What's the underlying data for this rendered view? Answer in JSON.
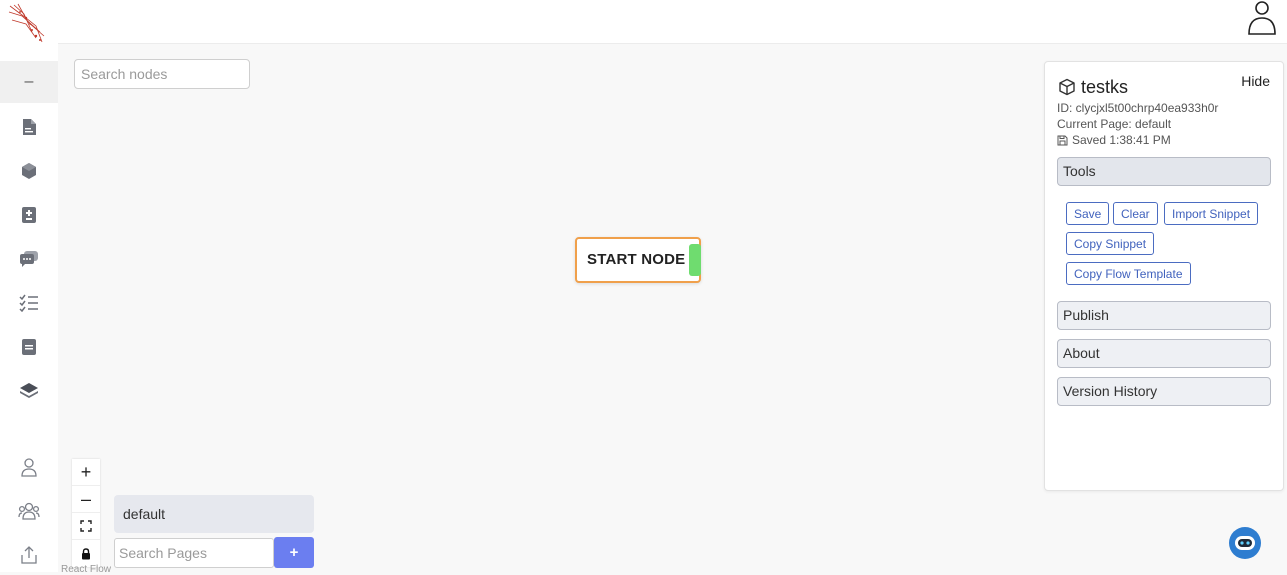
{
  "sidebar": {
    "collapse_label": "–",
    "items": [
      {
        "icon": "document-icon"
      },
      {
        "icon": "cube-icon"
      },
      {
        "icon": "file-plus-minus-icon"
      },
      {
        "icon": "chat-bubble-icon"
      },
      {
        "icon": "checklist-icon"
      },
      {
        "icon": "note-icon"
      },
      {
        "icon": "layers-icon"
      }
    ],
    "bottom_items": [
      {
        "icon": "user-icon"
      },
      {
        "icon": "users-icon"
      },
      {
        "icon": "share-upload-icon"
      }
    ]
  },
  "canvas": {
    "search_nodes_placeholder": "Search nodes",
    "start_node_label": "START NODE",
    "attribution": "React Flow"
  },
  "zoom": {
    "zoom_in": "+",
    "zoom_out": "–"
  },
  "pages": {
    "items": [
      {
        "label": "default"
      }
    ],
    "search_placeholder": "Search Pages",
    "add_label": "+"
  },
  "panel": {
    "project_name": "testks",
    "hide_label": "Hide",
    "id_text": "ID: clycjxl5t00chrp40ea933h0r",
    "current_page_text": "Current Page: default",
    "saved_text": "Saved 1:38:41 PM",
    "sections": {
      "tools": "Tools",
      "publish": "Publish",
      "about": "About",
      "version_history": "Version History"
    },
    "tools": {
      "save": "Save",
      "clear": "Clear",
      "import_snippet": "Import Snippet",
      "copy_snippet": "Copy Snippet",
      "copy_flow_template": "Copy Flow Template"
    }
  },
  "colors": {
    "accent": "#6b7ef0",
    "node_border": "#f0a04b",
    "node_handle": "#6fdc6f",
    "tool_button": "#4162bd",
    "chat_widget": "#2e7dd0"
  }
}
